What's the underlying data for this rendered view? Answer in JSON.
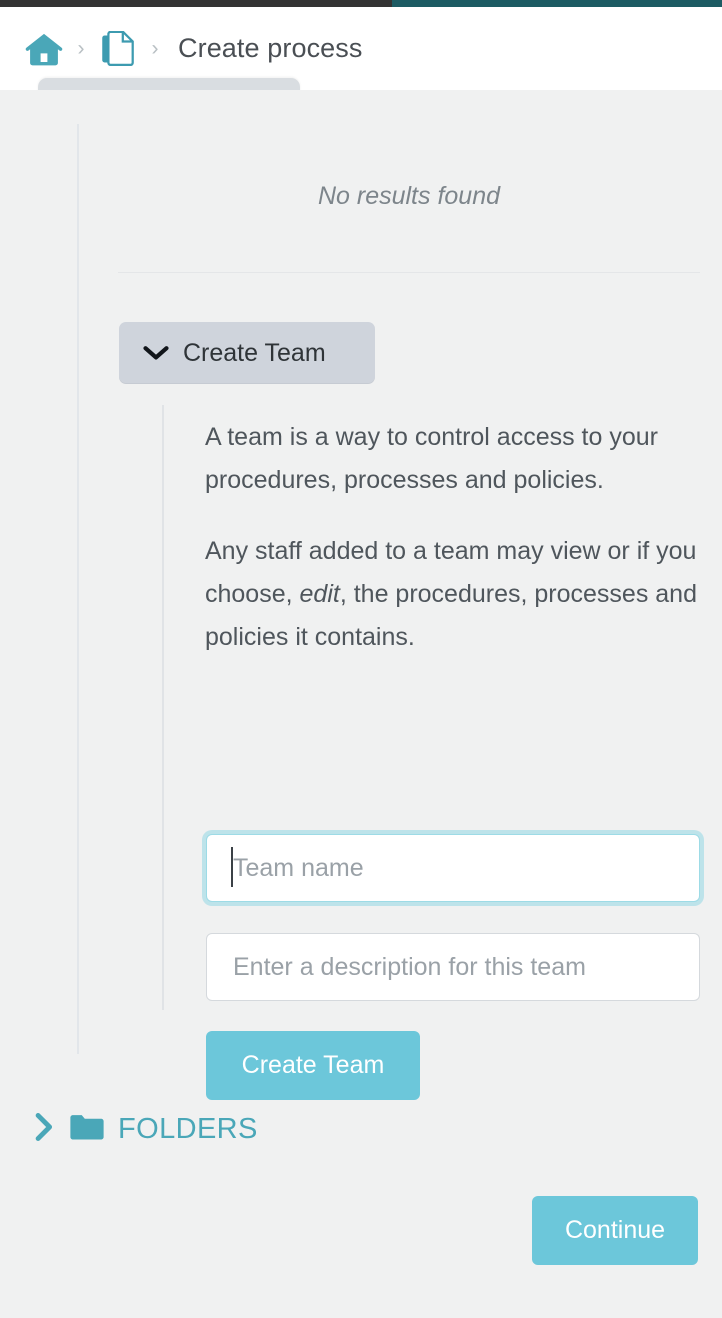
{
  "theme": {
    "page_bg": "#f0f1f1",
    "header_bg": "#ffffff",
    "accent_teal": "#4aa7b8",
    "button_teal": "#6cc7da",
    "strip_dark": "#333333",
    "strip_teal": "#1d5b63",
    "accordion_bg": "#cfd4dc",
    "focus_ring": "#9ddbe6"
  },
  "header": {
    "breadcrumb": {
      "home_icon": "home-icon",
      "separator": "›",
      "documents_icon": "copy-documents-icon",
      "current": "Create process"
    }
  },
  "main": {
    "no_results": "No results found",
    "accordion": {
      "icon": "chevron-down-icon",
      "label": "Create Team",
      "expanded": true
    },
    "description": {
      "paragraph_1": "A team is a way to control access to your procedures, processes and policies.",
      "paragraph_2_before": "Any staff added to a team may view or if you choose, ",
      "paragraph_2_emphasis": "edit",
      "paragraph_2_after": ", the procedures, processes and policies it contains."
    },
    "form": {
      "team_name": {
        "value": "",
        "placeholder": "Team name",
        "focused": true
      },
      "team_description": {
        "value": "",
        "placeholder": "Enter a description for this team"
      },
      "submit_label": "Create Team"
    }
  },
  "folders_section": {
    "chevron_icon": "chevron-right-icon",
    "folder_icon": "folder-icon",
    "label": "FOLDERS",
    "expanded": false
  },
  "footer": {
    "continue_label": "Continue"
  }
}
